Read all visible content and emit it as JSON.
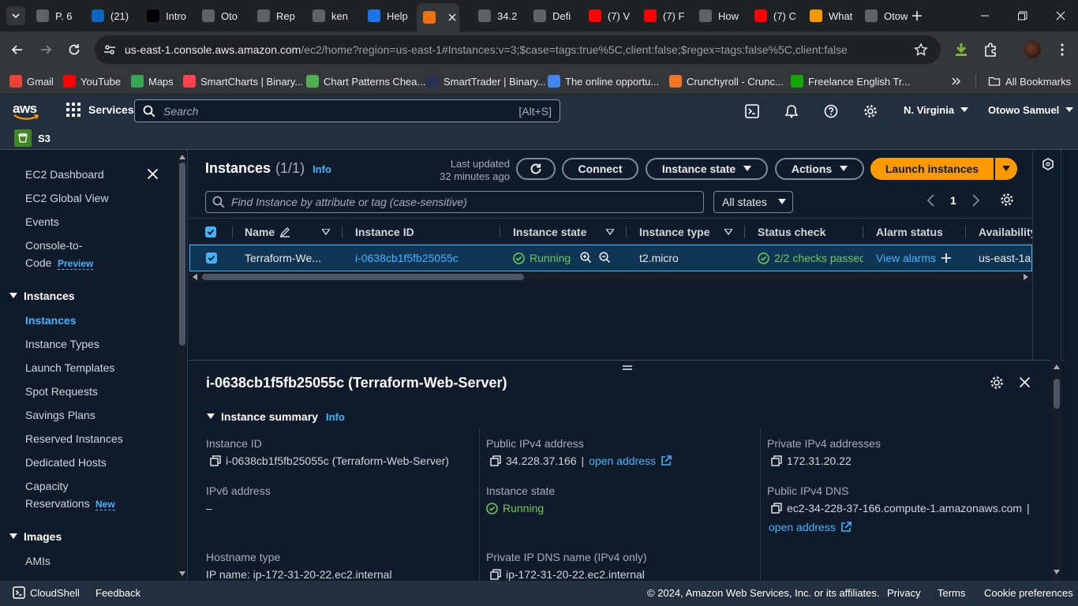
{
  "browser": {
    "tabs": [
      {
        "label": "P. 6",
        "color": "#5f6368"
      },
      {
        "label": "(21)",
        "color": "#0a66c2"
      },
      {
        "label": "Intro",
        "color": "#000000"
      },
      {
        "label": "Oto",
        "color": "#5f6368"
      },
      {
        "label": "Rep",
        "color": "#5f6368"
      },
      {
        "label": "ken",
        "color": "#5f6368"
      },
      {
        "label": "Help",
        "color": "#1a73e8"
      },
      {
        "label": "",
        "color": "#ec7211"
      },
      {
        "label": "34.2",
        "color": "#5f6368"
      },
      {
        "label": "Defi",
        "color": "#5f6368"
      },
      {
        "label": "(7) V",
        "color": "#ff0000"
      },
      {
        "label": "(7) F",
        "color": "#ff0000"
      },
      {
        "label": "How",
        "color": "#5f6368"
      },
      {
        "label": "(7) C",
        "color": "#ff0000"
      },
      {
        "label": "What",
        "color": "#f29900"
      },
      {
        "label": "Otow",
        "color": "#5f6368"
      }
    ],
    "url_host": "us-east-1.console.aws.amazon.com",
    "url_path": "/ec2/home?region=us-east-1#Instances:v=3;$case=tags:true%5C,client:false;$regex=tags:false%5C,client:false",
    "bookmarks": [
      {
        "label": "Gmail",
        "color": "#ea4335"
      },
      {
        "label": "YouTube",
        "color": "#ff0000"
      },
      {
        "label": "Maps",
        "color": "#34a853"
      },
      {
        "label": "SmartCharts | Binary...",
        "color": "#ff444f"
      },
      {
        "label": "Chart Patterns Chea...",
        "color": "#4caf50"
      },
      {
        "label": "SmartTrader | Binary...",
        "color": "#2a3052"
      },
      {
        "label": "The online opportu...",
        "color": "#4285f4"
      },
      {
        "label": "Crunchyroll - Crunc...",
        "color": "#f47521"
      },
      {
        "label": "Freelance English Tr...",
        "color": "#14a800"
      }
    ],
    "all_bookmarks": "All Bookmarks"
  },
  "aws": {
    "logo": "aws",
    "services": "Services",
    "search_placeholder": "Search",
    "search_shortcut": "[Alt+S]",
    "region": "N. Virginia",
    "user": "Otowo Samuel",
    "favorite": "S3"
  },
  "sidebar": {
    "items": [
      {
        "label": "EC2 Dashboard"
      },
      {
        "label": "EC2 Global View"
      },
      {
        "label": "Events"
      },
      {
        "label": "Console-to-"
      },
      {
        "label": "Code"
      },
      {
        "label": "Preview"
      }
    ],
    "instances_header": "Instances",
    "instances_items": [
      "Instances",
      "Instance Types",
      "Launch Templates",
      "Spot Requests",
      "Savings Plans",
      "Reserved Instances",
      "Dedicated Hosts",
      "Capacity",
      "Reservations"
    ],
    "new_badge": "New",
    "images_header": "Images",
    "images_items": [
      "AMIs"
    ]
  },
  "instances": {
    "title": "Instances",
    "count": "(1/1)",
    "info": "Info",
    "last_updated_1": "Last updated",
    "last_updated_2": "32 minutes ago",
    "connect": "Connect",
    "instance_state_btn": "Instance state",
    "actions": "Actions",
    "launch": "Launch instances",
    "filter_placeholder": "Find Instance by attribute or tag (case-sensitive)",
    "states_filter": "All states",
    "page": "1",
    "columns": [
      "Name",
      "Instance ID",
      "Instance state",
      "Instance type",
      "Status check",
      "Alarm status",
      "Availability"
    ],
    "row": {
      "name": "Terraform-We...",
      "id": "i-0638cb1f5fb25055c",
      "state": "Running",
      "type": "t2.micro",
      "status": "2/2 checks passed",
      "alarm": "View alarms",
      "az": "us-east-1a"
    }
  },
  "details": {
    "title": "i-0638cb1f5fb25055c (Terraform-Web-Server)",
    "summary": "Instance summary",
    "info": "Info",
    "instance_id_label": "Instance ID",
    "instance_id_value": "i-0638cb1f5fb25055c (Terraform-Web-Server)",
    "ipv6_label": "IPv6 address",
    "ipv6_value": "–",
    "hostname_label": "Hostname type",
    "hostname_value": "IP name: ip-172-31-20-22.ec2.internal",
    "public_ip_label": "Public IPv4 address",
    "public_ip_value": "34.228.37.166",
    "open_address": "open address",
    "state_label": "Instance state",
    "state_value": "Running",
    "private_dns_label": "Private IP DNS name (IPv4 only)",
    "private_dns_value": "ip-172-31-20-22.ec2.internal",
    "private_ip_label": "Private IPv4 addresses",
    "private_ip_value": "172.31.20.22",
    "public_dns_label": "Public IPv4 DNS",
    "public_dns_value": "ec2-34-228-37-166.compute-1.amazonaws.com"
  },
  "footer": {
    "cloudshell": "CloudShell",
    "feedback": "Feedback",
    "copyright": "© 2024, Amazon Web Services, Inc. or its affiliates.",
    "privacy": "Privacy",
    "terms": "Terms",
    "cookies": "Cookie preferences"
  }
}
